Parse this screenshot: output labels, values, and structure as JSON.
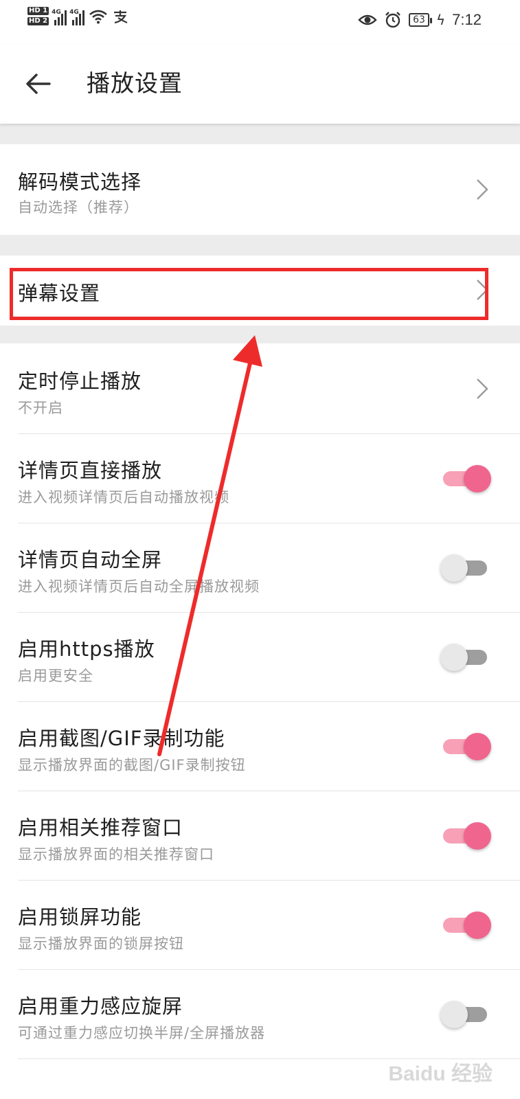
{
  "status_bar": {
    "hd1": "HD 1",
    "hd2": "HD 2",
    "net1": "4G",
    "net2": "4G",
    "battery": "63",
    "time": "7:12",
    "icons": [
      "eye-icon",
      "alarm-icon",
      "wifi-icon",
      "alipay-icon"
    ]
  },
  "header": {
    "title": "播放设置"
  },
  "settings": {
    "decode": {
      "title": "解码模式选择",
      "subtitle": "自动选择（推荐）"
    },
    "danmaku": {
      "title": "弹幕设置"
    },
    "timer": {
      "title": "定时停止播放",
      "subtitle": "不开启"
    },
    "items": [
      {
        "title": "详情页直接播放",
        "subtitle": "进入视频详情页后自动播放视频",
        "enabled": true
      },
      {
        "title": "详情页自动全屏",
        "subtitle": "进入视频详情页后自动全屏播放视频",
        "enabled": false
      },
      {
        "title": "启用https播放",
        "subtitle": "启用更安全",
        "enabled": false
      },
      {
        "title": "启用截图/GIF录制功能",
        "subtitle": "显示播放界面的截图/GIF录制按钮",
        "enabled": true
      },
      {
        "title": "启用相关推荐窗口",
        "subtitle": "显示播放界面的相关推荐窗口",
        "enabled": true
      },
      {
        "title": "启用锁屏功能",
        "subtitle": "显示播放界面的锁屏按钮",
        "enabled": true
      },
      {
        "title": "启用重力感应旋屏",
        "subtitle": "可通过重力感应切换半屏/全屏播放器",
        "enabled": false
      }
    ]
  },
  "colors": {
    "toggle_on": "#f0658e",
    "annotation": "#ee2b2b"
  },
  "watermark": "Baidu 经验"
}
